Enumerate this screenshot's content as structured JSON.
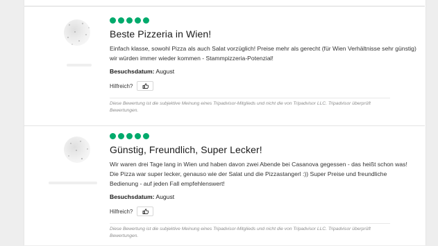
{
  "reviews": [
    {
      "bubbles": 5,
      "title": "Beste Pizzeria in Wien!",
      "body": "Einfach klasse, sowohl Pizza als auch Salat vorzüglich! Preise mehr als gerecht (für Wien Verhältnisse sehr günstig) wir würden immer wieder kommen - Stammpizzeria-Potenzial!",
      "visit_label": "Besuchsdatum:",
      "visit_value": "August",
      "helpful_label": "Hilfreich?",
      "disclaimer": "Diese Bewertung ist die subjektive Meinung eines Tripadvisor-Mitglieds und nicht die von Tripadvisor LLC. Tripadvisor überprüft Bewertungen."
    },
    {
      "bubbles": 5,
      "title": "Günstig, Freundlich, Super Lecker!",
      "body": "Wir waren drei Tage lang in Wien und haben davon zwei Abende bei Casanova gegessen - das heißt schon was! Die Pizza war super lecker, genauso wie der Salat und die Pizzastangerl :)) Super Preise und freundliche Bedienung - auf jeden Fall empfehlenswert!",
      "visit_label": "Besuchsdatum:",
      "visit_value": "August",
      "helpful_label": "Hilfreich?",
      "disclaimer": "Diese Bewertung ist die subjektive Meinung eines Tripadvisor-Mitglieds und nicht die von Tripadvisor LLC. Tripadvisor überprüft Bewertungen."
    }
  ],
  "colors": {
    "bubble": "#00aa6c"
  },
  "icons": {
    "thumb": "thumbs-up-icon"
  }
}
